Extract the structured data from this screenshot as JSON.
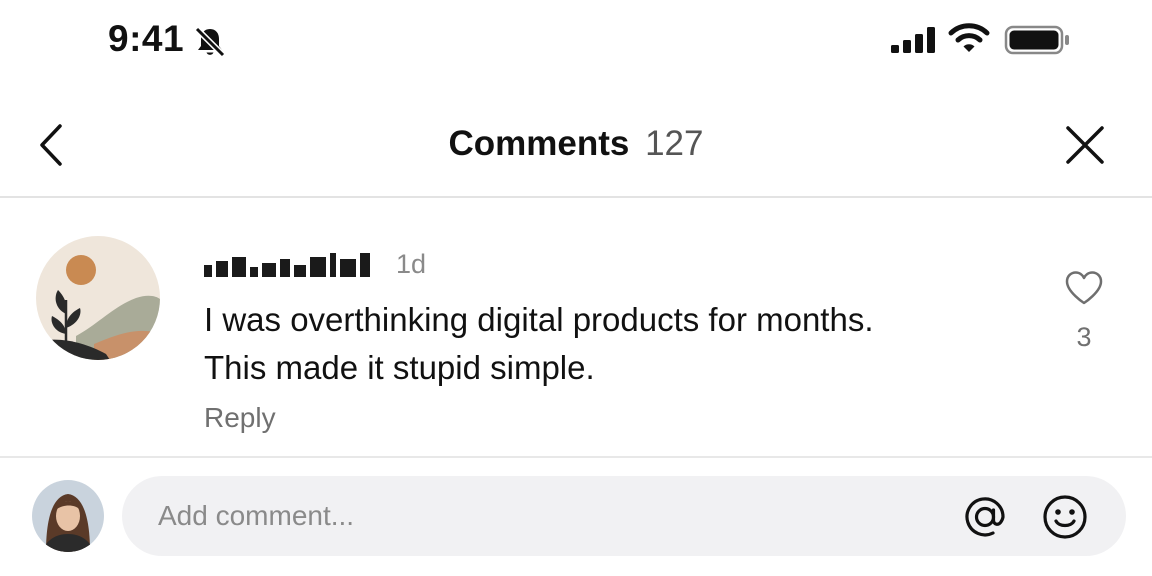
{
  "status_bar": {
    "time": "9:41",
    "icons": [
      "bell-off-icon",
      "signal-icon",
      "wifi-icon",
      "battery-icon"
    ]
  },
  "header": {
    "title": "Comments",
    "count": "127",
    "icons": [
      "back-chevron-icon",
      "close-icon"
    ]
  },
  "comment": {
    "username": "[redacted]",
    "timestamp": "1d",
    "text_line1": "I was overthinking digital products for months.",
    "text_line2": "This made it stupid simple.",
    "reply_label": "Reply",
    "like_count": "3",
    "icons": [
      "heart-outline-icon"
    ]
  },
  "composer": {
    "placeholder": "Add comment...",
    "icons": [
      "mention-icon",
      "emoji-icon"
    ]
  },
  "colors": {
    "background": "#ffffff",
    "text_primary": "#111111",
    "text_secondary": "#707070",
    "input_background": "#f1f1f3",
    "divider": "#e3e3e3"
  }
}
